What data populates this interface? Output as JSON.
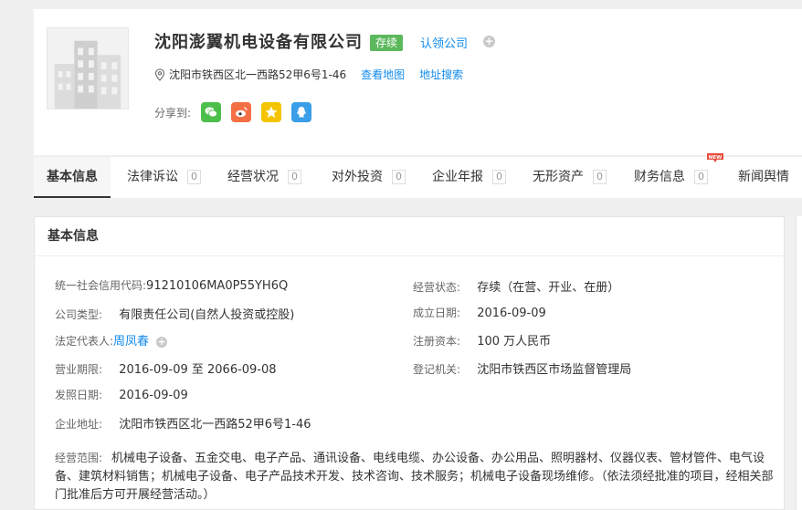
{
  "company": {
    "name": "沈阳澎翼机电设备有限公司",
    "status": "存续",
    "claim_label": "认领公司",
    "address": "沈阳市铁西区北一西路52甲6号1-46",
    "map_link": "查看地图",
    "addr_search_link": "地址搜索",
    "share_label": "分享到:"
  },
  "share_buttons": [
    {
      "icon": "wechat-icon",
      "color": "#4cbf4a"
    },
    {
      "icon": "weibo-icon",
      "color": "#f36f46"
    },
    {
      "icon": "qzone-icon",
      "color": "#f5c400"
    },
    {
      "icon": "qq-icon",
      "color": "#3a9ee8"
    }
  ],
  "tabs": [
    {
      "label": "基本信息",
      "active": true
    },
    {
      "label": "法律诉讼",
      "count": "0"
    },
    {
      "label": "经营状况",
      "count": "0"
    },
    {
      "label": "对外投资",
      "count": "0"
    },
    {
      "label": "企业年报",
      "count": "0"
    },
    {
      "label": "无形资产",
      "count": "0"
    },
    {
      "label": "财务信息",
      "count": "0",
      "badge": "NEW"
    },
    {
      "label": "新闻舆情"
    }
  ],
  "panel": {
    "title": "基本信息",
    "left": [
      {
        "label": "统一社会信用代码:",
        "value": "91210106MA0P55YH6Q"
      },
      {
        "label": "公司类型:",
        "value": "有限责任公司(自然人投资或控股)"
      },
      {
        "label": "法定代表人:",
        "value": "周凤春"
      },
      {
        "label": "营业期限:",
        "value": "2016-09-09 至 2066-09-08"
      },
      {
        "label": "发照日期:",
        "value": "2016-09-09"
      },
      {
        "label": "企业地址:",
        "value": "沈阳市铁西区北一西路52甲6号1-46"
      }
    ],
    "right": [
      {
        "label": "经营状态:",
        "value": "存续（在营、开业、在册）"
      },
      {
        "label": "成立日期:",
        "value": "2016-09-09"
      },
      {
        "label": "注册资本:",
        "value": "100 万人民币"
      },
      {
        "label": "登记机关:",
        "value": "沈阳市铁西区市场监督管理局"
      }
    ],
    "scope_label": "经营范围:",
    "scope_value": "机械电子设备、五金交电、电子产品、通讯设备、电线电缆、办公设备、办公用品、照明器材、仪器仪表、管材管件、电气设备、建筑材料销售；机械电子设备、电子产品技术开发、技术咨询、技术服务；机械电子设备现场维修。（依法须经批准的项目，经相关部门批准后方可开展经营活动。）"
  },
  "colors": {
    "link": "#128bed",
    "status_green": "#5cb85c"
  }
}
